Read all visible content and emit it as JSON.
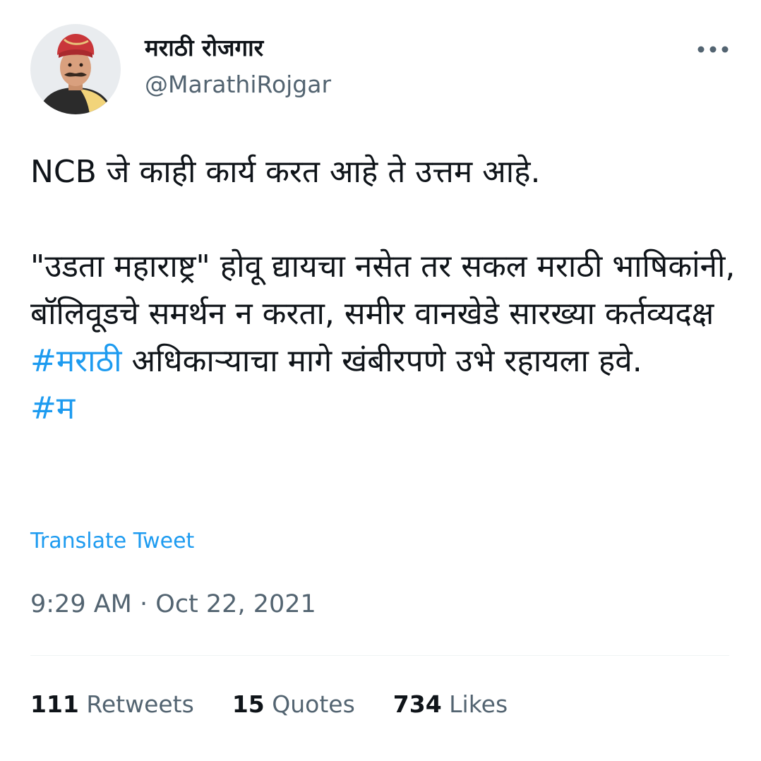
{
  "colors": {
    "link": "#1d9bf0",
    "text": "#0f1419",
    "secondary": "#536471",
    "divider": "#eff3f4"
  },
  "author": {
    "display_name": "मराठी रोजगार",
    "handle": "@MarathiRojgar",
    "avatar_icon": "user-avatar-portrait"
  },
  "more_icon": "more-horizontal-icon",
  "tweet": {
    "line1": "NCB जे काही कार्य करत आहे ते उत्तम आहे.",
    "para2_text": "\"उडता महाराष्ट्र\" होवू द्यायचा नसेत तर सकल मराठी भाषिकांनी, बॉलिवूडचे समर्थन न करता, समीर वानखेडे सारख्या कर्तव्यदक्ष ",
    "hashtag1": "#मराठी",
    "para2_end": " अधिकाऱ्याचा मागे खंबीरपणे उभे रहायला हवे.",
    "hashtag2": "#म"
  },
  "translate_label": "Translate Tweet",
  "timestamp": {
    "time": "9:29 AM",
    "separator": " · ",
    "date": "Oct 22, 2021"
  },
  "stats": {
    "retweets_count": "111",
    "retweets_label": "Retweets",
    "quotes_count": "15",
    "quotes_label": "Quotes",
    "likes_count": "734",
    "likes_label": "Likes"
  }
}
